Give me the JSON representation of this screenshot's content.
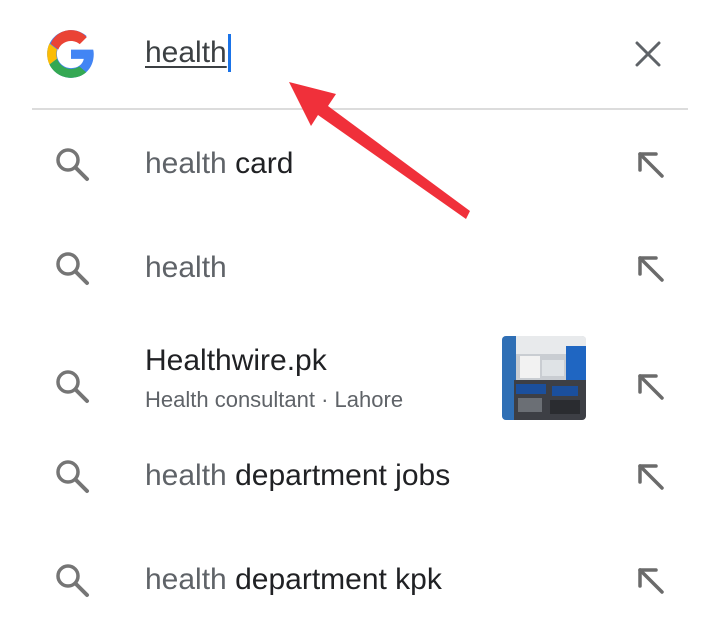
{
  "search": {
    "query": "health",
    "logo_icon": "google-g-logo",
    "clear_icon": "close-icon"
  },
  "suggestions": [
    {
      "prefix": "health",
      "suffix": " card",
      "icon": "search-icon",
      "action_icon": "fill-query-arrow-icon"
    },
    {
      "prefix": "health",
      "suffix": "",
      "icon": "search-icon",
      "action_icon": "fill-query-arrow-icon"
    },
    {
      "title": "Healthwire.pk",
      "subtitle": "Health consultant · Lahore",
      "icon": "search-icon",
      "action_icon": "fill-query-arrow-icon",
      "thumbnail": "office-photo"
    },
    {
      "prefix": "health",
      "suffix": " department jobs",
      "icon": "search-icon",
      "action_icon": "fill-query-arrow-icon"
    },
    {
      "prefix": "health",
      "suffix": " department kpk",
      "icon": "search-icon",
      "action_icon": "fill-query-arrow-icon"
    }
  ],
  "colors": {
    "annotation_arrow": "#f0303a",
    "caret": "#1a73e8"
  }
}
